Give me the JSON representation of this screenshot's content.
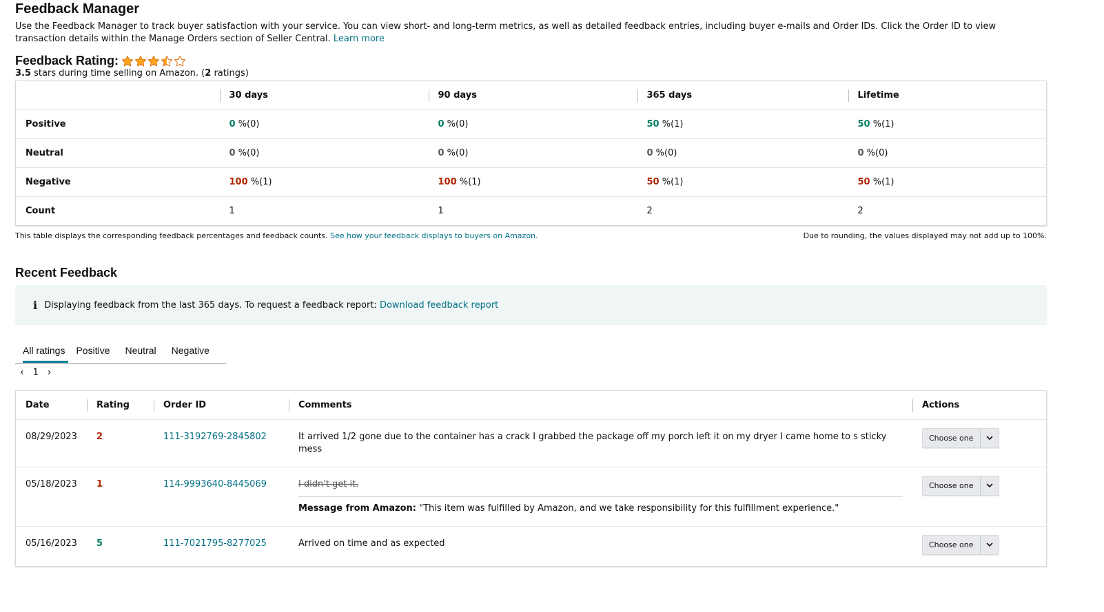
{
  "header": {
    "title": "Feedback Manager",
    "intro": "Use the Feedback Manager to track buyer satisfaction with your service. You can view short- and long-term metrics, as well as detailed feedback entries, including buyer e-mails and Order IDs. Click the Order ID to view transaction details within the Manage Orders section of Seller Central.",
    "learn_more": "Learn more"
  },
  "rating": {
    "label": "Feedback Rating:",
    "stars_value": 3.5,
    "stars_max": 5,
    "score": "3.5",
    "sub_middle": " stars during time selling on Amazon. (",
    "count": "2",
    "sub_end": " ratings)",
    "star_color": "#ffa41c"
  },
  "metrics": {
    "columns": [
      "30 days",
      "90 days",
      "365 days",
      "Lifetime"
    ],
    "rows": [
      {
        "label": "Positive",
        "kind": "pos",
        "cells": [
          {
            "n": "0",
            "c": "(0)"
          },
          {
            "n": "0",
            "c": "(0)"
          },
          {
            "n": "50",
            "c": "(1)"
          },
          {
            "n": "50",
            "c": "(1)"
          }
        ]
      },
      {
        "label": "Neutral",
        "kind": "neu",
        "cells": [
          {
            "n": "0",
            "c": "(0)"
          },
          {
            "n": "0",
            "c": "(0)"
          },
          {
            "n": "0",
            "c": "(0)"
          },
          {
            "n": "0",
            "c": "(0)"
          }
        ]
      },
      {
        "label": "Negative",
        "kind": "neg",
        "cells": [
          {
            "n": "100",
            "c": "(1)"
          },
          {
            "n": "100",
            "c": "(1)"
          },
          {
            "n": "50",
            "c": "(1)"
          },
          {
            "n": "50",
            "c": "(1)"
          }
        ]
      }
    ],
    "count_label": "Count",
    "counts": [
      "1",
      "1",
      "2",
      "2"
    ],
    "pct_sign": " %",
    "footnote_left": "This table displays the corresponding feedback percentages and feedback counts.",
    "footnote_link": "See how your feedback displays to buyers on Amazon.",
    "footnote_right": "Due to rounding, the values displayed may not add up to 100%."
  },
  "recent": {
    "title": "Recent Feedback",
    "info_icon": "i",
    "info_text": "Displaying feedback from the last 365 days. To request a feedback report:",
    "info_link": "Download feedback report",
    "tabs": [
      "All ratings",
      "Positive",
      "Neutral",
      "Negative"
    ],
    "page": "1",
    "columns": {
      "date": "Date",
      "rating": "Rating",
      "order": "Order ID",
      "comments": "Comments",
      "actions": "Actions"
    },
    "entries": [
      {
        "date": "08/29/2023",
        "rating": "2",
        "order_id": "111-3192769-2845802",
        "comment": "It arrived 1/2 gone due to the container has a crack I grabbed the package off my porch left it on my dryer I came home to s sticky mess",
        "action": "Choose one"
      },
      {
        "date": "05/18/2023",
        "rating": "1",
        "order_id": "114-9993640-8445069",
        "comment": "I didn't get it.",
        "amazon_label": "Message from Amazon:",
        "amazon_msg": " \"This item was fulfilled by Amazon, and we take responsibility for this fulfillment experience.\"",
        "action": "Choose one"
      },
      {
        "date": "05/16/2023",
        "rating": "5",
        "order_id": "111-7021795-8277025",
        "comment": "Arrived on time and as expected",
        "action": "Choose one"
      }
    ]
  },
  "colors": {
    "positive": "#067d62",
    "negative": "#b12704",
    "link": "#007185",
    "tab_accent": "#008296"
  }
}
